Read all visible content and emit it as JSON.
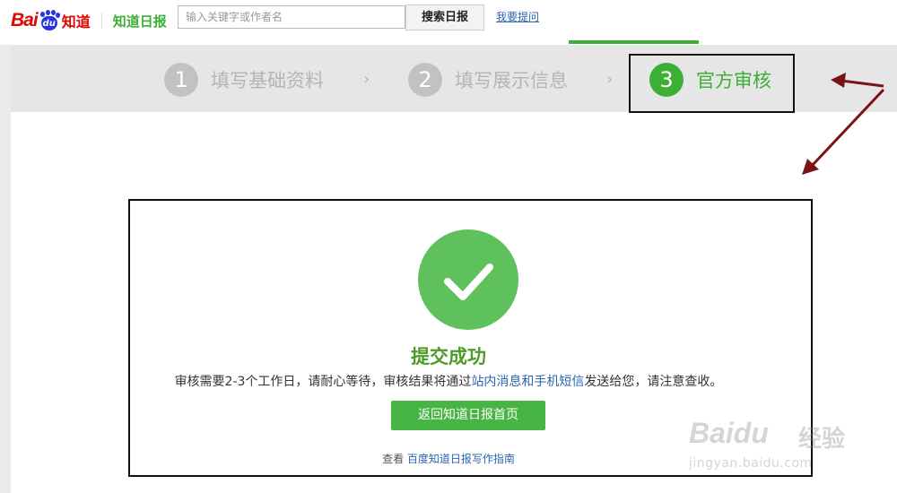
{
  "header": {
    "logo_bai": "Bai",
    "logo_du": "du",
    "logo_zhidao": "知道",
    "logo_ribao": "知道日报",
    "search_placeholder": "输入关键字或作者名",
    "search_button": "搜索日报",
    "ask_link": "我要提问"
  },
  "steps": [
    {
      "number": "1",
      "label": "填写基础资料",
      "active": false
    },
    {
      "number": "2",
      "label": "填写展示信息",
      "active": false
    },
    {
      "number": "3",
      "label": "官方审核",
      "active": true
    }
  ],
  "step_separator": "›",
  "success": {
    "title": "提交成功",
    "desc_part1": "审核需要2-3个工作日，请耐心等待，审核结果将通过",
    "desc_highlight": "站内消息和手机短信",
    "desc_part2": "发送给您，请注意查收。",
    "button_label": "返回知道日报首页",
    "guide_prefix": "查看",
    "guide_link": "百度知道日报写作指南"
  },
  "watermark": {
    "logo": "Baidu",
    "name": "经验",
    "url": "jingyan.baidu.com"
  },
  "colors": {
    "accent_green": "#3cb034",
    "check_green": "#5fc15b",
    "link_blue": "#2d64b3",
    "brand_red": "#e10601",
    "brand_blue": "#2932e1",
    "annotation_arrow": "#7a1414"
  }
}
